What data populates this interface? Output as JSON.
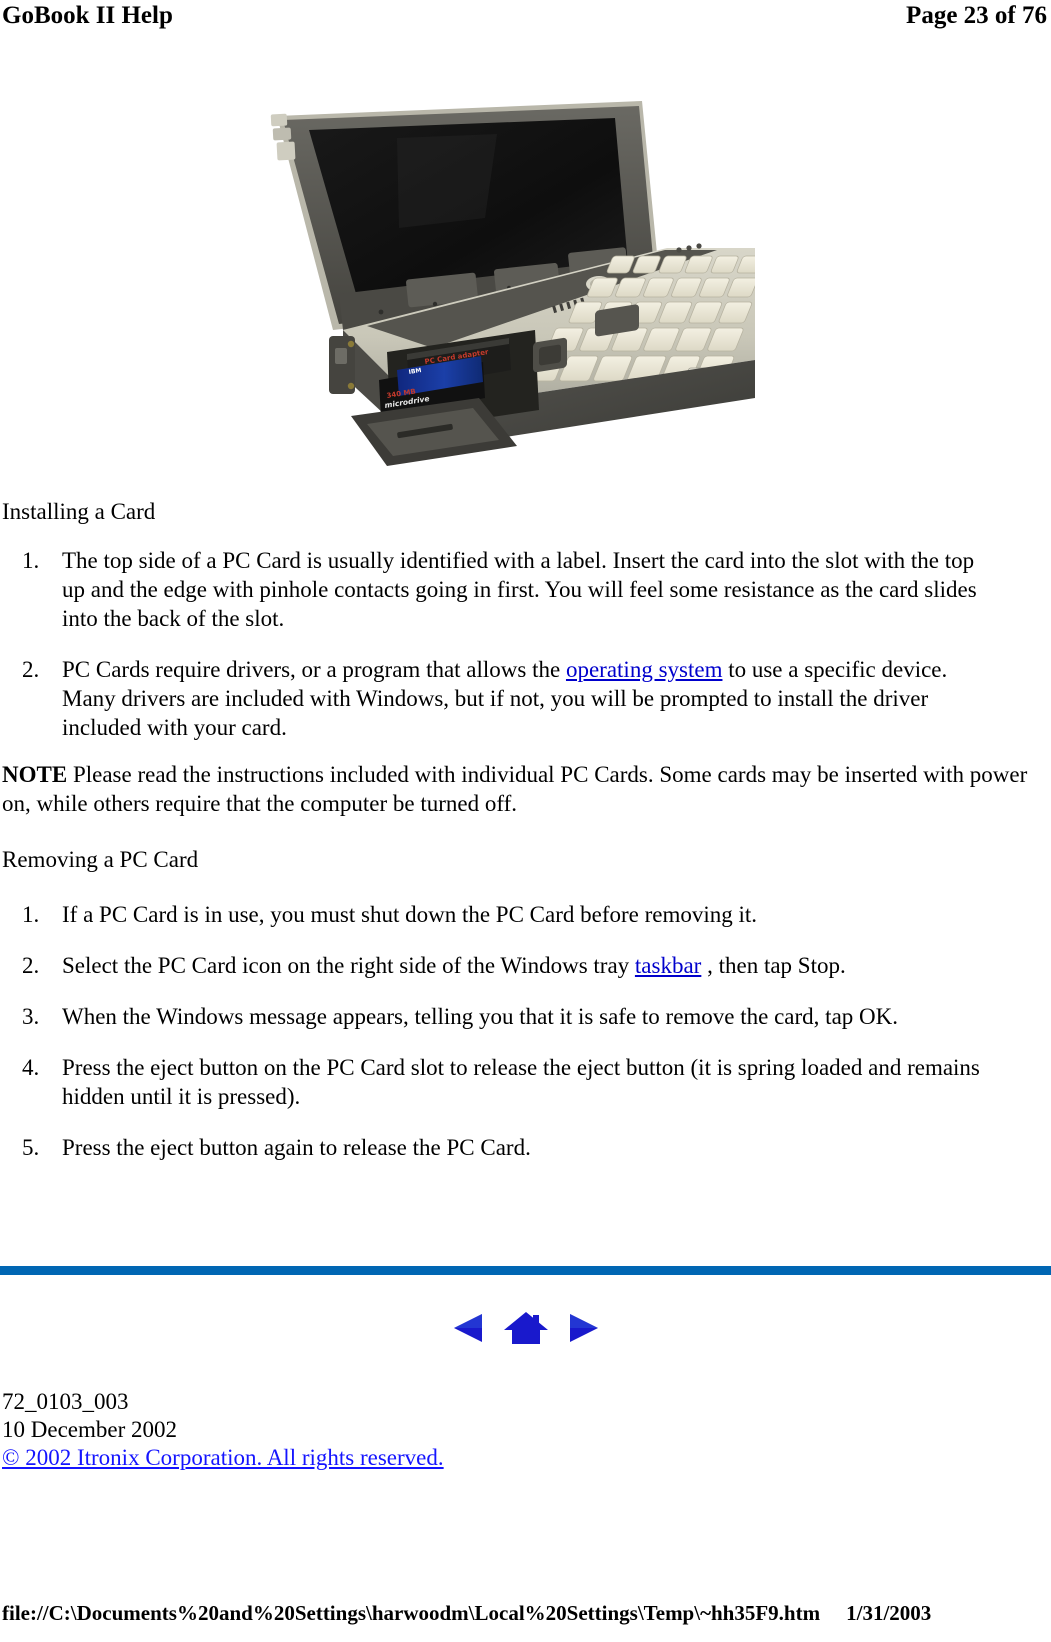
{
  "header": {
    "doc_title": "GoBook II Help",
    "page_indicator": "Page 23 of 76"
  },
  "figure": {
    "alt_name": "gobook-pc-card-slot-photo",
    "caption": "",
    "card_label_top": "PC Card adapter",
    "card_label_bottom": "340 MB microdrive",
    "card_brand": "IBM"
  },
  "sections": {
    "installing": {
      "heading": "Installing a Card",
      "steps": [
        {
          "num": "1.",
          "text": "The top side of a PC Card is usually identified with a label. Insert the card into the slot with the top up and the edge with pinhole contacts going in first. You will feel some resistance as the card slides into the back of the slot."
        },
        {
          "num": "2.",
          "pre": "PC Cards require drivers, or a program that allows the ",
          "link": "operating system",
          "post": " to use a specific device. Many drivers are included with Windows, but if not, you will be prompted to install the driver included with your card."
        }
      ]
    },
    "note": {
      "label": "NOTE",
      "text": " Please read the instructions included with individual PC Cards. Some cards may be inserted with power on, while others require that the computer be turned off."
    },
    "removing": {
      "heading": "Removing a PC Card",
      "steps": [
        {
          "num": "1.",
          "text": "If a PC Card is in use, you must shut down the PC Card before removing it."
        },
        {
          "num": "2.",
          "pre": "Select the PC Card icon on the right side of the Windows tray ",
          "link": "taskbar",
          "post": " , then tap Stop."
        },
        {
          "num": "3.",
          "text": "When the Windows message appears, telling you that it is safe to remove the card, tap OK."
        },
        {
          "num": "4.",
          "text": "Press the eject button on the PC Card slot to release the eject button (it is spring loaded and remains hidden until it is pressed)."
        },
        {
          "num": "5.",
          "text": "Press the eject button again to release the PC Card."
        }
      ]
    }
  },
  "navigation": {
    "previous_label": "previous-page",
    "home_label": "home-page",
    "next_label": "next-page",
    "icon_color": "#1919CC"
  },
  "footer": {
    "doc_number": "72_0103_003",
    "doc_date": "10 December 2002",
    "copyright": "© 2002 Itronix Corporation.  All rights reserved."
  },
  "print_footer": {
    "url": "file://C:\\Documents%20and%20Settings\\harwoodm\\Local%20Settings\\Temp\\~hh35F9.htm",
    "date": "1/31/2003"
  },
  "colors": {
    "rule": "#0066B3",
    "body_link": "#0000CC",
    "footer_link": "#1414FF"
  }
}
